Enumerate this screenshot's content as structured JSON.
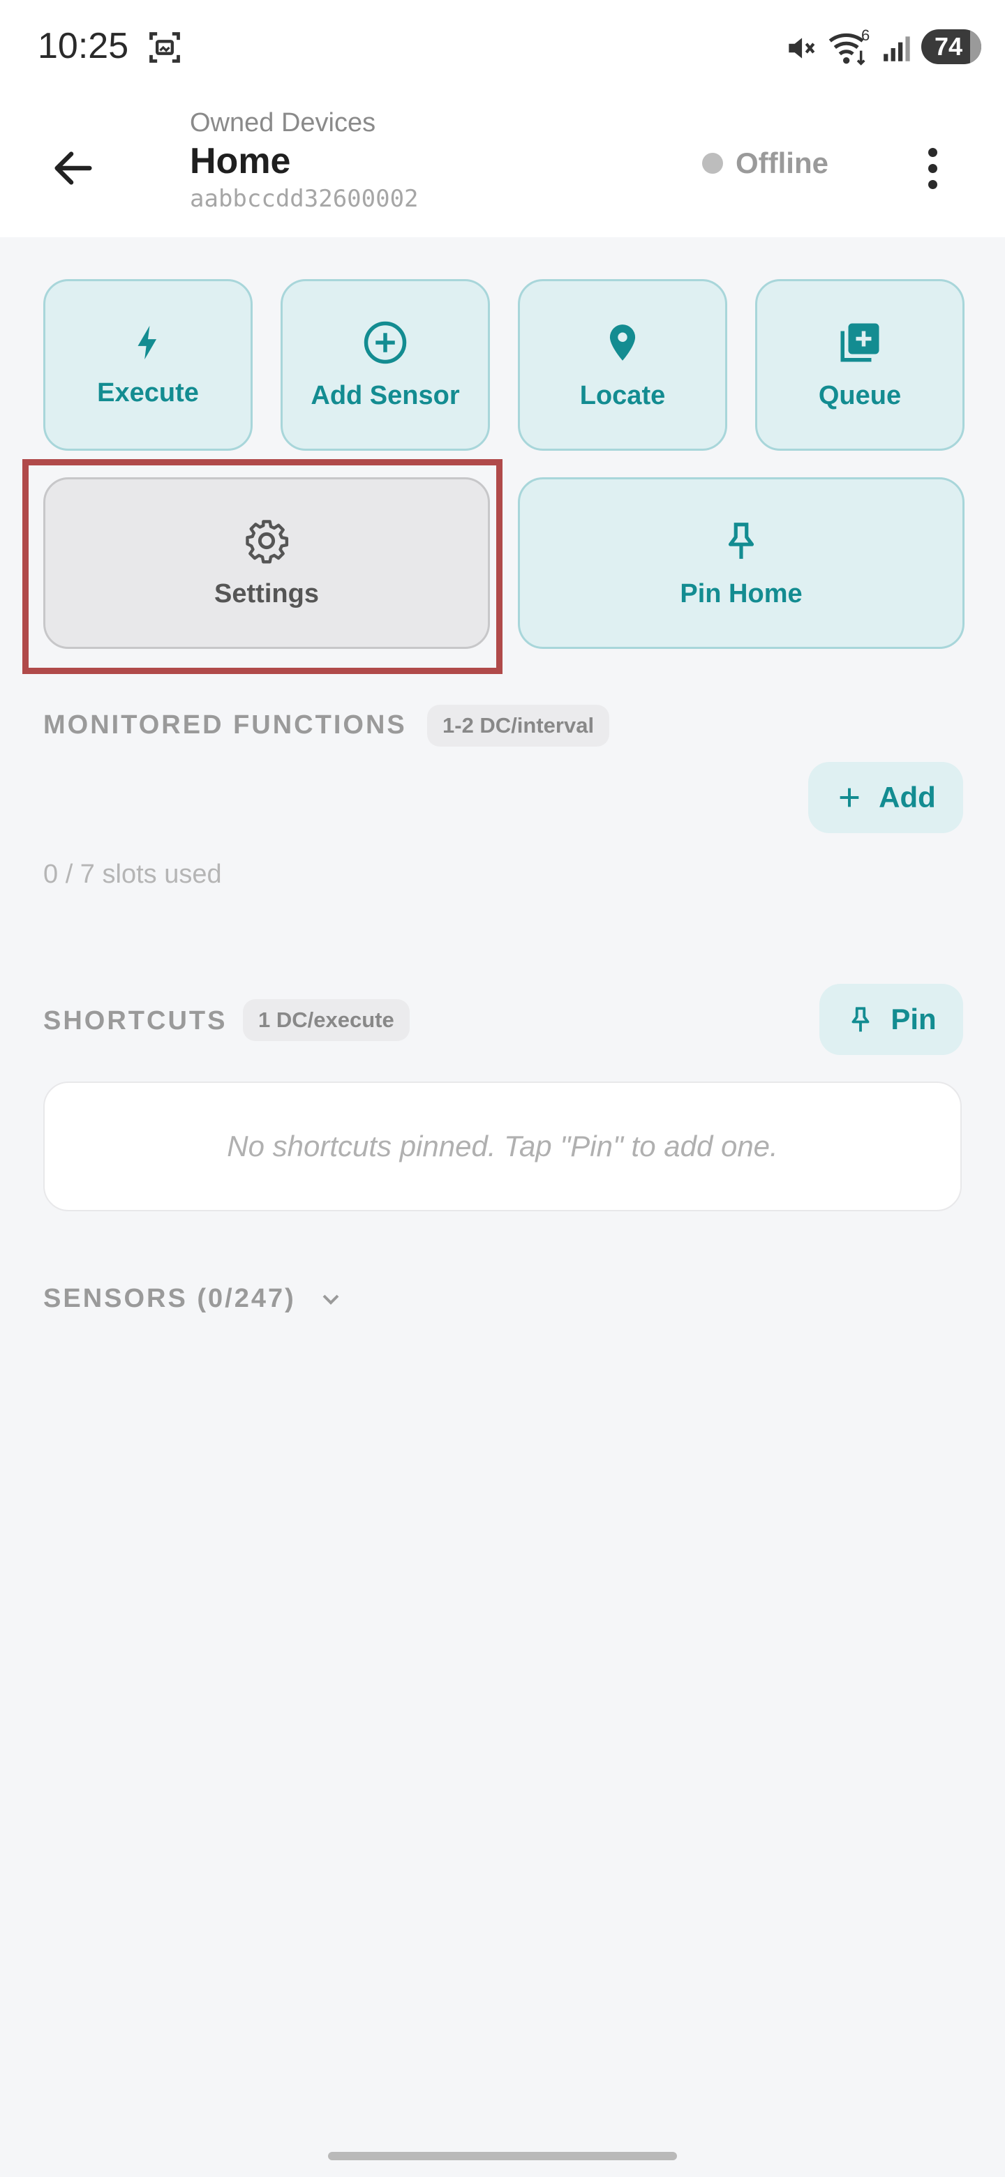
{
  "status_bar": {
    "time": "10:25",
    "battery": "74",
    "network_label": "6",
    "icons": [
      "screenshot-icon",
      "mute-icon",
      "wifi-icon",
      "signal-icon",
      "battery-icon"
    ]
  },
  "app_bar": {
    "parent": "Owned Devices",
    "title": "Home",
    "device_id": "aabbccdd32600002",
    "status": "Offline",
    "status_color": "#bdbdbd"
  },
  "actions": [
    {
      "label": "Execute",
      "icon": "bolt-icon"
    },
    {
      "label": "Add Sensor",
      "icon": "add-circle-icon"
    },
    {
      "label": "Locate",
      "icon": "location-pin-icon"
    },
    {
      "label": "Queue",
      "icon": "queue-add-icon"
    },
    {
      "label": "Settings",
      "icon": "gear-icon",
      "selected": true
    },
    {
      "label": "Pin Home",
      "icon": "pin-icon"
    }
  ],
  "monitored": {
    "title": "MONITORED FUNCTIONS",
    "chip": "1-2 DC/interval",
    "add_label": "Add",
    "slots_text": "0 / 7 slots used"
  },
  "shortcuts": {
    "title": "SHORTCUTS",
    "chip": "1 DC/execute",
    "pin_label": "Pin",
    "empty_text": "No shortcuts pinned. Tap \"Pin\" to add one."
  },
  "sensors": {
    "title": "SENSORS (0/247)"
  },
  "colors": {
    "accent": "#138c91",
    "tile_bg": "#dff0f2",
    "highlight": "#b04a4a"
  }
}
